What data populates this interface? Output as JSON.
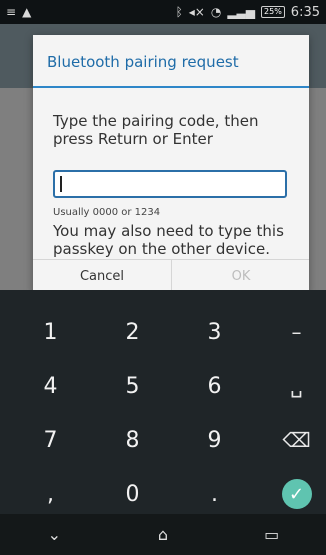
{
  "status_bar": {
    "battery_percent": "25%",
    "time": "6:35"
  },
  "dialog": {
    "title": "Bluetooth pairing request",
    "message": "Type the pairing code, then press Return or Enter",
    "input_value": "",
    "hint": "Usually 0000 or 1234",
    "passkey_note": "You may also need to type this passkey on the other device.",
    "buttons": {
      "cancel": "Cancel",
      "ok": "OK"
    }
  },
  "keyboard": {
    "row1": [
      "1",
      "2",
      "3",
      "–"
    ],
    "row2": [
      "4",
      "5",
      "6",
      "␣"
    ],
    "row3": [
      "7",
      "8",
      "9",
      "⌫"
    ],
    "row4": [
      ",",
      "0",
      ".",
      "✓"
    ]
  },
  "colors": {
    "title_blue": "#1f6ca8",
    "divider_blue": "#2e86c8",
    "done_teal": "#5fc4b0"
  }
}
